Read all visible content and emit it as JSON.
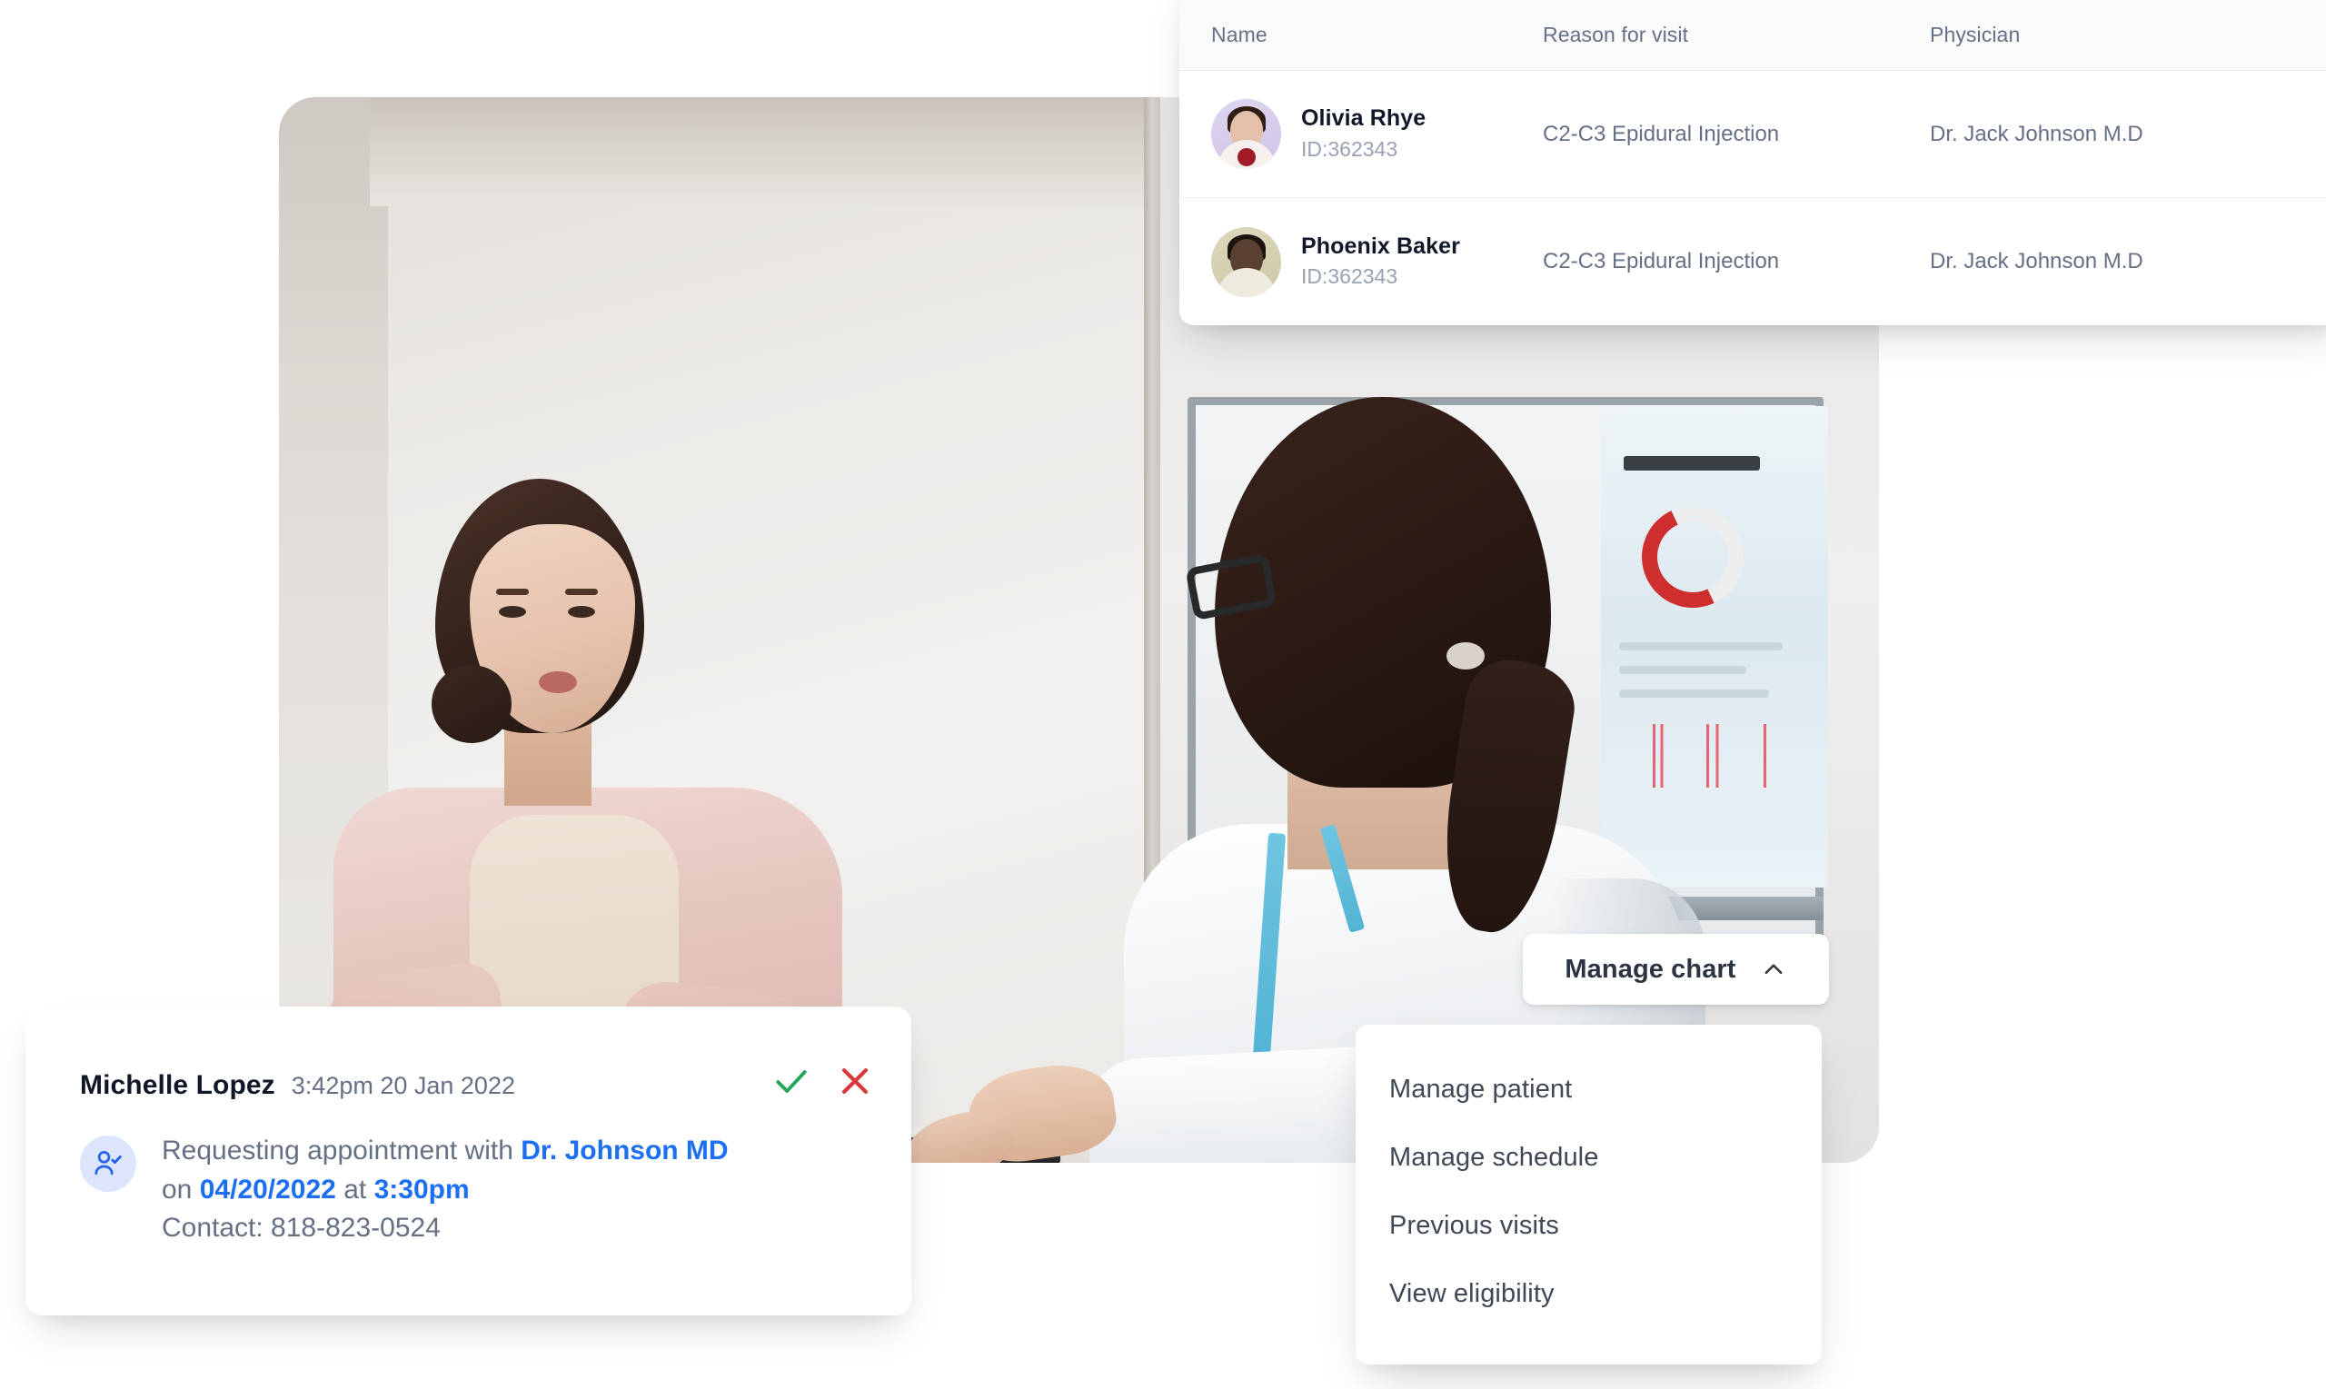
{
  "patient_table": {
    "columns": [
      {
        "key": "name",
        "label": "Name"
      },
      {
        "key": "reason",
        "label": "Reason for visit"
      },
      {
        "key": "physician",
        "label": "Physician"
      }
    ],
    "rows": [
      {
        "name": "Olivia Rhye",
        "id": "ID:362343",
        "reason": "C2-C3 Epidural Injection",
        "physician": "Dr. Jack Johnson M.D",
        "avatar": "avatar-olivia-rhye"
      },
      {
        "name": "Phoenix Baker",
        "id": "ID:362343",
        "reason": "C2-C3 Epidural Injection",
        "physician": "Dr. Jack Johnson M.D",
        "avatar": "avatar-phoenix-baker"
      }
    ]
  },
  "notification": {
    "sender": "Michelle Lopez",
    "timestamp": "3:42pm 20 Jan 2022",
    "icon": "user-check-icon",
    "accept_icon": "check-icon",
    "decline_icon": "close-icon",
    "message": {
      "line1_prefix": "Requesting appointment with ",
      "doctor": "Dr. Johnson MD",
      "line2_prefix": "on ",
      "date": "04/20/2022",
      "line2_mid": " at ",
      "time": "3:30pm",
      "line3": "Contact: 818-823-0524"
    },
    "colors": {
      "link": "#1d6ff2",
      "accept": "#22a559",
      "decline": "#d93838",
      "icon_bg": "#dde5fd"
    }
  },
  "manage_chart": {
    "label": "Manage chart",
    "chevron": "chevron-up-icon",
    "menu_items": [
      "Manage patient",
      "Manage schedule",
      "Previous visits",
      "View eligibility"
    ]
  },
  "photo": {
    "alt": "Doctor consulting with a patient in an exam room"
  }
}
